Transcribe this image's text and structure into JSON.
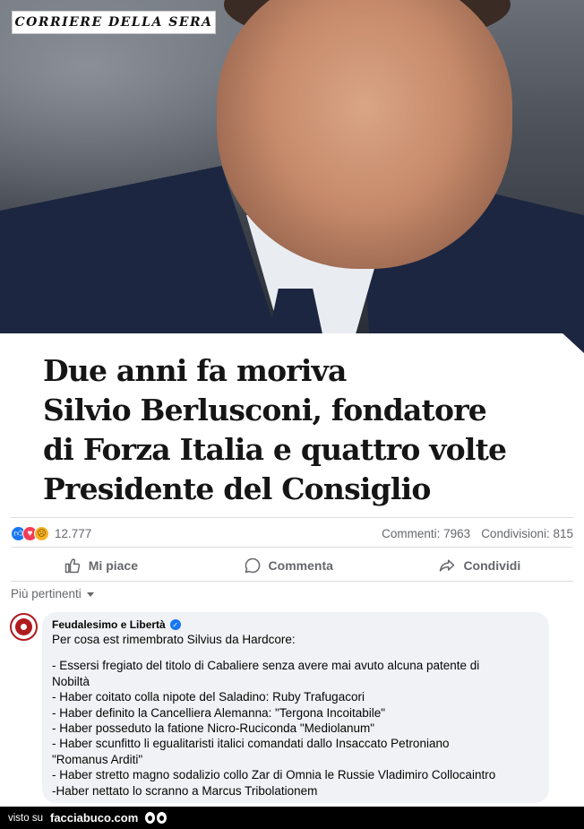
{
  "photo": {
    "logo_text": "CORRIERE DELLA SERA"
  },
  "headline": {
    "lines": [
      "Due anni fa moriva",
      "Silvio Berlusconi, fondatore",
      "di Forza Italia e quattro volte",
      "Presidente del Consiglio"
    ]
  },
  "stats": {
    "reactions": [
      "like-icon",
      "love-icon",
      "sad-icon"
    ],
    "reaction_count": "12.777",
    "comments": "Commenti: 7963",
    "shares": "Condivisioni: 815"
  },
  "actions": {
    "like": "Mi piace",
    "comment": "Commenta",
    "share": "Condividi"
  },
  "filter": {
    "label": "Più pertinenti"
  },
  "comment": {
    "author": "Feudalesimo e Libertà",
    "intro": "Per cosa est rimembrato Silvius da Hardcore:",
    "lines": [
      "- Essersi fregiato del titolo di Cabaliere senza avere mai avuto alcuna patente di",
      "Nobiltà",
      "- Haber coitato colla nipote del Saladino: Ruby Trafugacori",
      "- Haber definito la Cancelliera Alemanna: \"Tergona Incoitabile\"",
      "- Haber posseduto la fatione Nicro-Ruciconda \"Mediolanum\"",
      "- Haber scunfitto li egualitaristi italici comandati dallo Insaccato Petroniano",
      "\"Romanus Arditi\"",
      "- Haber stretto magno sodalizio collo Zar di Omnia le Russie Vladimiro Collocaintro",
      "-Haber nettato lo scranno a Marcus Tribolationem"
    ]
  },
  "footer": {
    "visto": "visto su",
    "site": "facciabuco.com"
  },
  "colors": {
    "accent": "#1877f2",
    "text": "#050505",
    "muted": "#65676b",
    "bubble": "#f0f2f5"
  }
}
